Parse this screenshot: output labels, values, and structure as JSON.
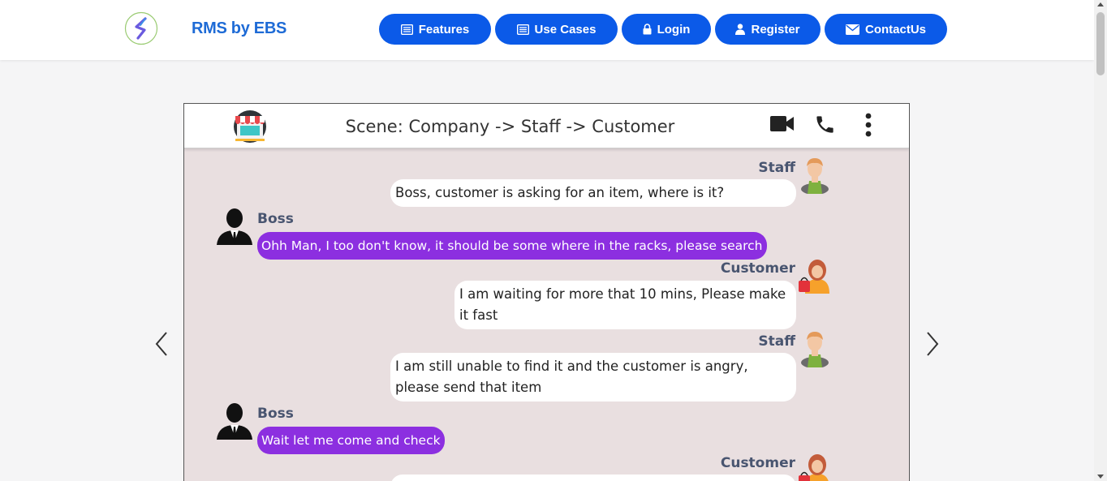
{
  "brand": {
    "name": "RMS by EBS"
  },
  "nav": {
    "features": "Features",
    "use_cases": "Use Cases",
    "login": "Login",
    "register": "Register",
    "contact": "ContactUs"
  },
  "chat": {
    "title": "Scene: Company -> Staff -> Customer",
    "messages": [
      {
        "sender": "Staff",
        "text": "Boss, customer is asking for an item, where is it?"
      },
      {
        "sender": "Boss",
        "text": "Ohh Man, I too don't know, it should be some where in the racks, please search"
      },
      {
        "sender": "Customer",
        "text": "I am waiting for more that 10 mins, Please make it fast"
      },
      {
        "sender": "Staff",
        "text": "I am still unable to find it and the customer is angry, please send that item"
      },
      {
        "sender": "Boss",
        "text": "Wait let me come and check"
      },
      {
        "sender": "Customer",
        "text": ""
      }
    ]
  },
  "colors": {
    "brand": "#1e6bd6",
    "button": "#0b5ae8",
    "boss_bubble": "#8c2fe0",
    "chat_bg": "#e9dfe0"
  },
  "icons": [
    "logo-icon",
    "list-icon",
    "lock-icon",
    "user-icon",
    "envelope-icon",
    "store-icon",
    "video-icon",
    "phone-icon",
    "more-vertical-icon",
    "chevron-left-icon",
    "chevron-right-icon"
  ]
}
